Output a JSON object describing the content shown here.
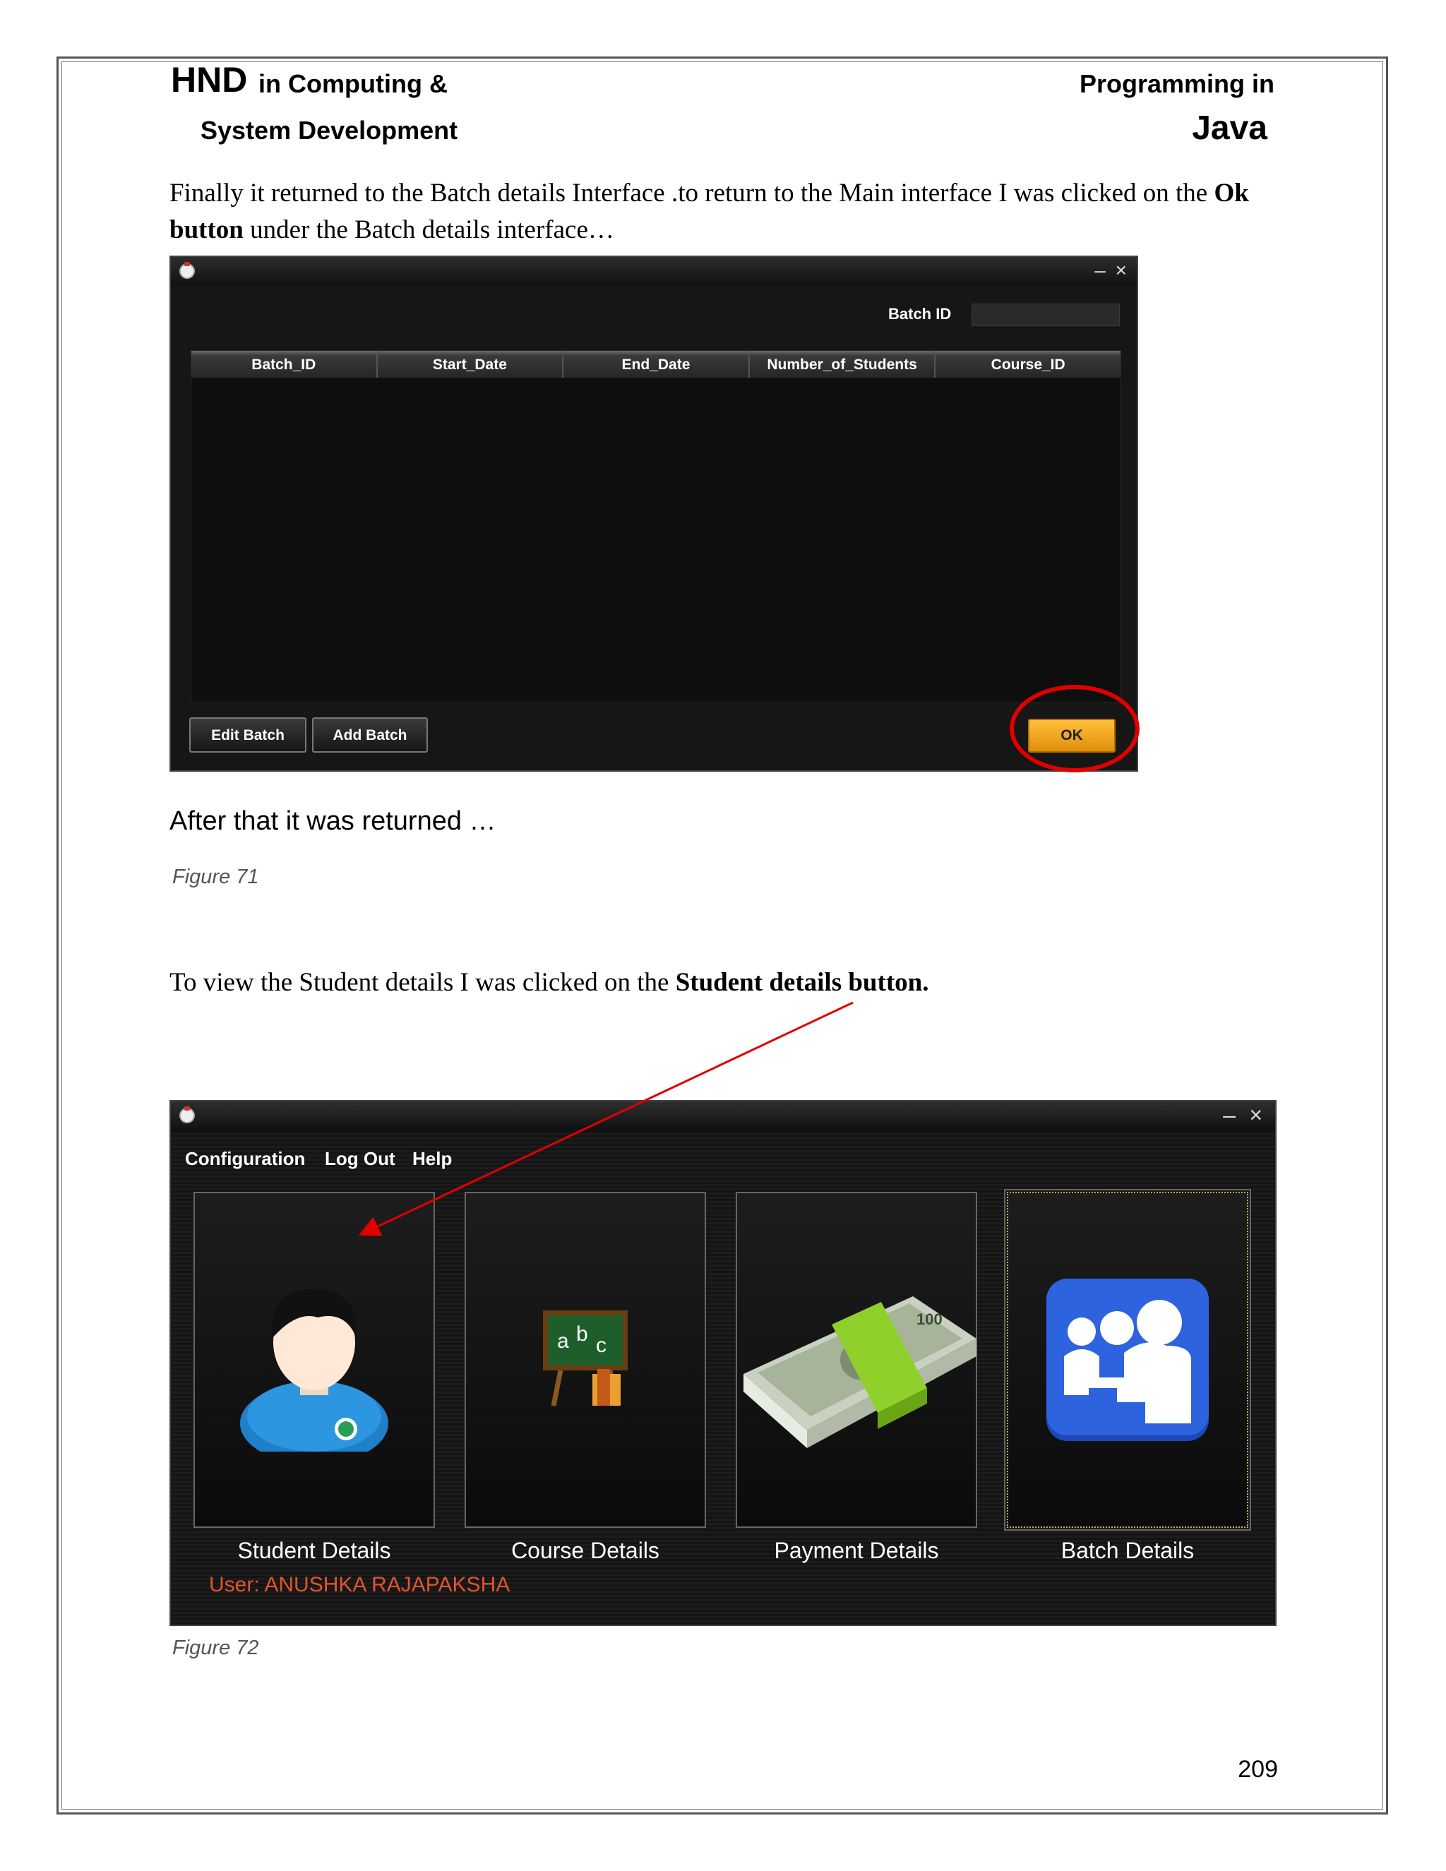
{
  "header": {
    "left_title_main": "HND",
    "left_title_rest": "in Computing &",
    "left_subtitle": "System Development",
    "right_title": "Programming in",
    "right_subtitle": "Java"
  },
  "body": {
    "para1_prefix": "Finally  it  returned  to the  Batch details  Interface  .to return  to the  Main  interface  I was clicked  on the",
    "para1_bold": "Ok button",
    "para1_suffix": "under  the  Batch  details  interface…",
    "after_text": "After that it was returned …",
    "figure1_caption": "Figure 71",
    "para2_prefix": "To  view  the  Student  details  I was  clicked   on the",
    "para2_bold": "Student  details  button.",
    "figure2_caption": "Figure 72",
    "page_number": "209"
  },
  "batch_window": {
    "minimize_glyph": "–",
    "close_glyph": "×",
    "search_label": "Batch ID",
    "search_value": "",
    "columns": [
      "Batch_ID",
      "Start_Date",
      "End_Date",
      "Number_of_Students",
      "Course_ID"
    ],
    "buttons": {
      "edit": "Edit Batch",
      "add": "Add Batch",
      "ok": "OK"
    },
    "colors": {
      "ok_button": "#f5a623",
      "highlight_circle": "#e00000"
    }
  },
  "main_window": {
    "minimize_glyph": "–",
    "close_glyph": "×",
    "menu": [
      "Configuration",
      "Log Out",
      "Help"
    ],
    "tiles": [
      {
        "label": "Student Details",
        "icon": "student-icon"
      },
      {
        "label": "Course Details",
        "icon": "chalkboard-abc-icon"
      },
      {
        "label": "Payment Details",
        "icon": "money-stack-icon"
      },
      {
        "label": "Batch Details",
        "icon": "group-users-icon"
      }
    ],
    "chalkboard_letters": [
      "a",
      "b",
      "c"
    ],
    "money_denomination": "100",
    "user_label": "User: ANUSHKA RAJAPAKSHA",
    "colors": {
      "user_label": "#e0542c",
      "arrow": "#e00000"
    }
  }
}
